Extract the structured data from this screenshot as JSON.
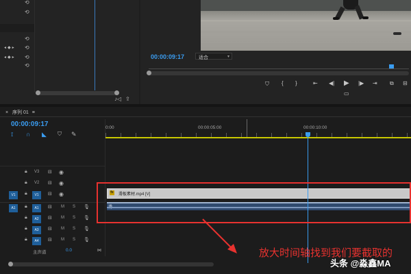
{
  "program_monitor": {
    "timecode": "00:00:09:17",
    "fit_label": "适合",
    "fit_caret": "▾"
  },
  "sequence": {
    "tab_close": "×",
    "tab_title": "序列 01",
    "tab_menu": "≡",
    "timecode": "00:00:09:17"
  },
  "ruler": {
    "labels": [
      "0:00",
      "00:00:05:00",
      "00:00:10:00"
    ]
  },
  "tracks": {
    "video": [
      {
        "source": "",
        "name": "V3"
      },
      {
        "source": "",
        "name": "V2"
      },
      {
        "source": "V1",
        "name": "V1"
      }
    ],
    "audio": [
      {
        "source": "A1",
        "name": "A1"
      },
      {
        "source": "",
        "name": "A2"
      },
      {
        "source": "",
        "name": "A3"
      },
      {
        "source": "",
        "name": "A4"
      }
    ],
    "mute_label": "M",
    "solo_label": "S",
    "master_label": "主声道",
    "master_value": "0.0"
  },
  "clips": {
    "video_label": "滑板素材.mp4 [V]",
    "audio_label": "滑"
  },
  "annotation": {
    "text": "放大时间轴找到我们要截取的",
    "color": "#e8322f"
  },
  "watermark": {
    "text": "头条 @淼鑫MA"
  },
  "colors": {
    "accent": "#3a9cf0",
    "highlight_box": "#e8322f",
    "video_clip": "#c8c8c8",
    "audio_clip": "#9fb4d0",
    "work_area": "#c8c800"
  }
}
